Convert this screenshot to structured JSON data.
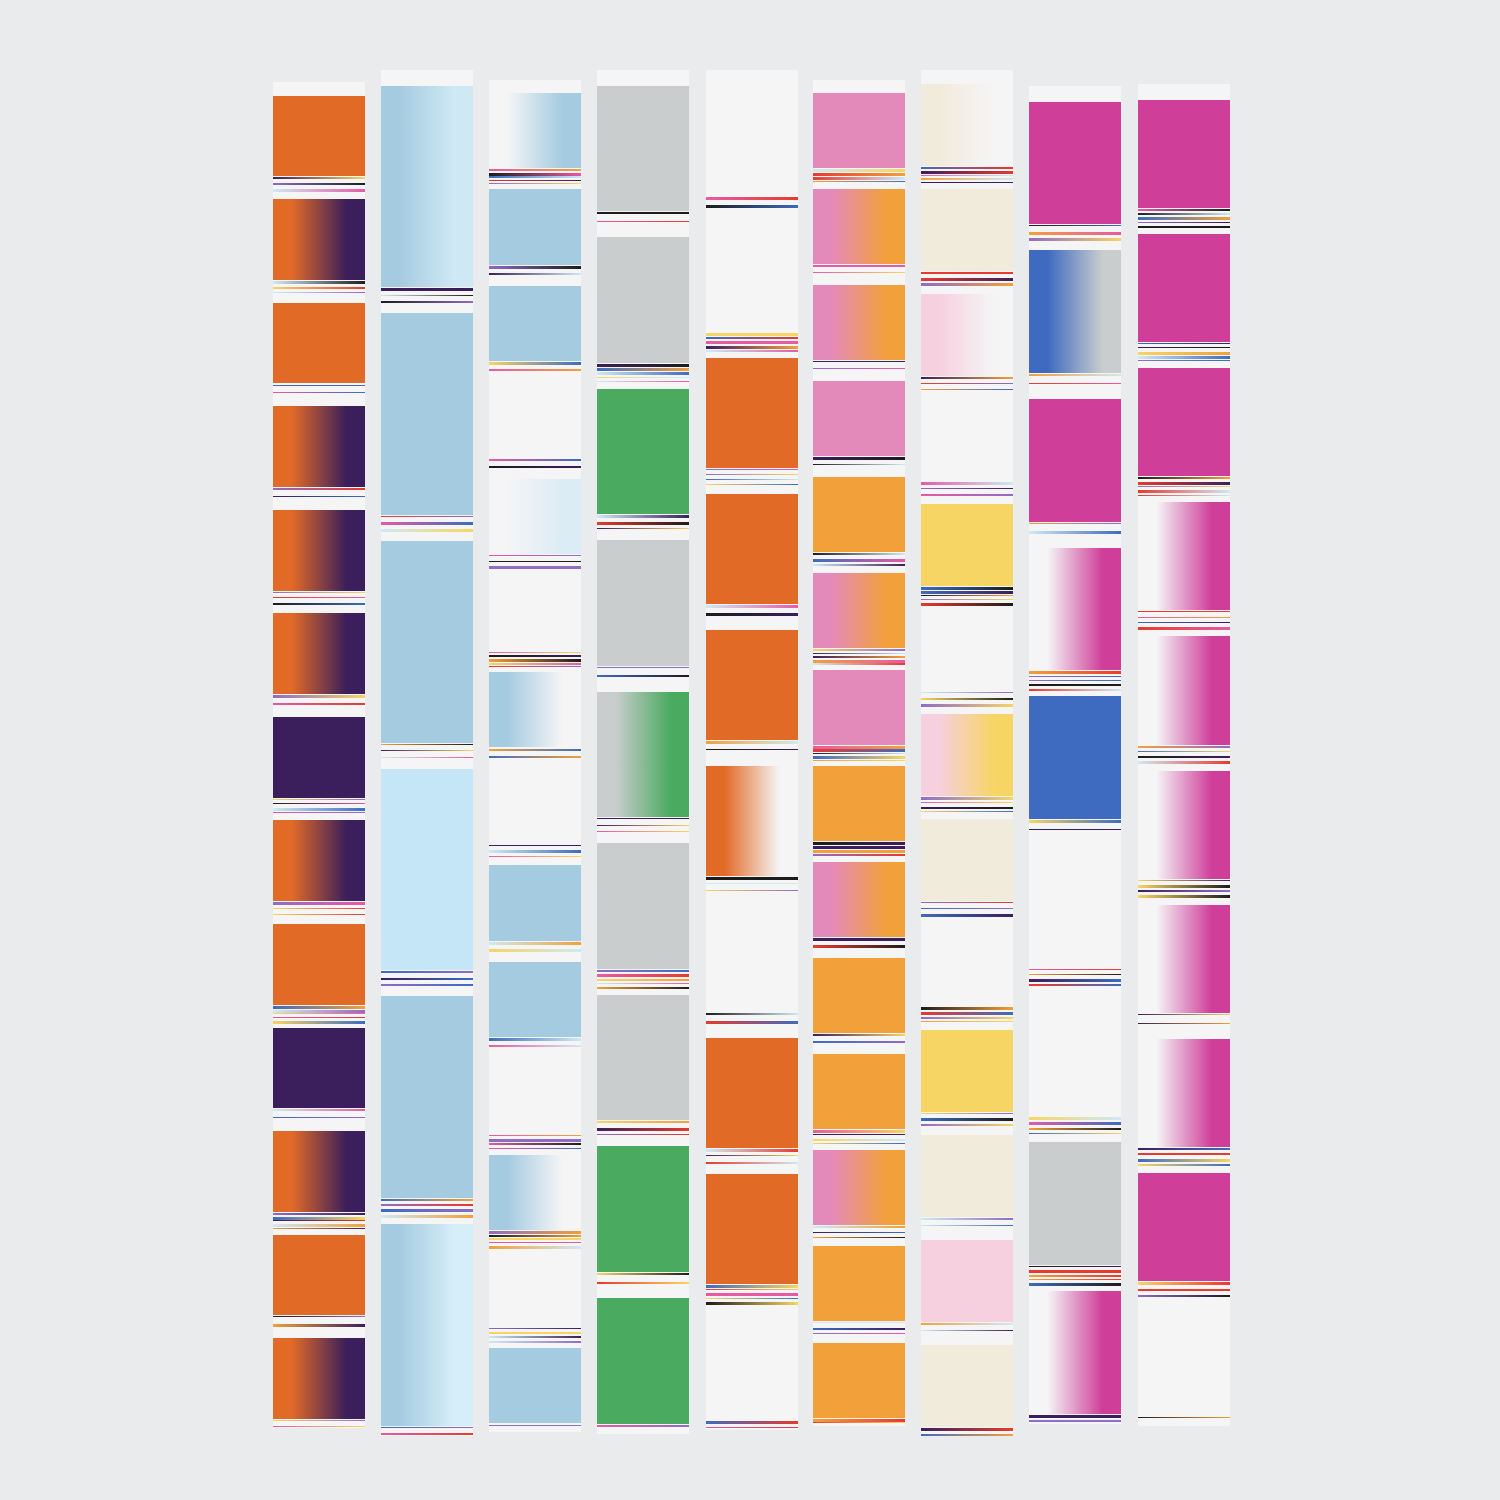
{
  "artwork": {
    "background": "#e9ebec",
    "stripe_base": "#f5f5f6",
    "columns": [
      {
        "name": "orange-indigo",
        "colors": [
          "#e26a27",
          "#3a1f5c"
        ],
        "bands": [
          {
            "kind": "solid",
            "c": "#e26a27"
          },
          {
            "kind": "fade",
            "from": "#e26a27",
            "to": "#3a1f5c"
          },
          {
            "kind": "solid",
            "c": "#e26a27"
          },
          {
            "kind": "fade",
            "from": "#e26a27",
            "to": "#3a1f5c"
          },
          {
            "kind": "fade",
            "from": "#e26a27",
            "to": "#3a1f5c"
          },
          {
            "kind": "fade",
            "from": "#e26a27",
            "to": "#3a1f5c"
          },
          {
            "kind": "solid",
            "c": "#3a1f5c"
          },
          {
            "kind": "fade",
            "from": "#e26a27",
            "to": "#3a1f5c"
          },
          {
            "kind": "solid",
            "c": "#e26a27"
          },
          {
            "kind": "solid",
            "c": "#3a1f5c"
          },
          {
            "kind": "fade",
            "from": "#e26a27",
            "to": "#3a1f5c"
          },
          {
            "kind": "solid",
            "c": "#e26a27"
          },
          {
            "kind": "fade",
            "from": "#e26a27",
            "to": "#3a1f5c"
          }
        ]
      },
      {
        "name": "light-blue",
        "colors": [
          "#a5cbe0",
          "#c5e6f6"
        ],
        "bands": [
          {
            "kind": "fade",
            "from": "#a5cbe0",
            "to": "#cfe9f4"
          },
          {
            "kind": "solid",
            "c": "#a5cbe0"
          },
          {
            "kind": "solid",
            "c": "#a5cbe0"
          },
          {
            "kind": "solid",
            "c": "#c5e6f6"
          },
          {
            "kind": "solid",
            "c": "#a5cbe0"
          },
          {
            "kind": "fade",
            "from": "#a5cbe0",
            "to": "#d6eef8"
          }
        ]
      },
      {
        "name": "blue-white",
        "colors": [
          "#a5cbe0",
          "#f5f5f6"
        ],
        "bands": [
          {
            "kind": "fade",
            "from": "#f5f5f6",
            "to": "#a5cbe0"
          },
          {
            "kind": "solid",
            "c": "#a5cbe0"
          },
          {
            "kind": "solid",
            "c": "#a5cbe0"
          },
          {
            "kind": "solid",
            "c": "#f5f5f6"
          },
          {
            "kind": "fade",
            "from": "#f5f5f6",
            "to": "#dcecf4"
          },
          {
            "kind": "solid",
            "c": "#f5f5f6"
          },
          {
            "kind": "fade",
            "from": "#a5cbe0",
            "to": "#f5f5f6"
          },
          {
            "kind": "solid",
            "c": "#f5f5f6"
          },
          {
            "kind": "solid",
            "c": "#a5cbe0"
          },
          {
            "kind": "solid",
            "c": "#a5cbe0"
          },
          {
            "kind": "solid",
            "c": "#f5f5f6"
          },
          {
            "kind": "fade",
            "from": "#a5cbe0",
            "to": "#f5f5f6"
          },
          {
            "kind": "solid",
            "c": "#f5f5f6"
          },
          {
            "kind": "solid",
            "c": "#a5cbe0"
          }
        ]
      },
      {
        "name": "grey-green",
        "colors": [
          "#c9cdce",
          "#4aaa5f",
          "#3e6bbf"
        ],
        "bands": [
          {
            "kind": "solid",
            "c": "#c9cdce"
          },
          {
            "kind": "solid",
            "c": "#c9cdce"
          },
          {
            "kind": "solid",
            "c": "#4aaa5f"
          },
          {
            "kind": "solid",
            "c": "#c9cdce"
          },
          {
            "kind": "fade",
            "from": "#c9cdce",
            "to": "#4aaa5f"
          },
          {
            "kind": "solid",
            "c": "#c9cdce"
          },
          {
            "kind": "solid",
            "c": "#c9cdce"
          },
          {
            "kind": "solid",
            "c": "#4aaa5f"
          },
          {
            "kind": "solid",
            "c": "#4aaa5f"
          }
        ]
      },
      {
        "name": "white-orange",
        "colors": [
          "#f5f5f6",
          "#e26a27"
        ],
        "bands": [
          {
            "kind": "solid",
            "c": "#f5f5f6"
          },
          {
            "kind": "solid",
            "c": "#f5f5f6"
          },
          {
            "kind": "solid",
            "c": "#e26a27"
          },
          {
            "kind": "solid",
            "c": "#e26a27"
          },
          {
            "kind": "solid",
            "c": "#e26a27"
          },
          {
            "kind": "fade",
            "from": "#e26a27",
            "to": "#f5f5f6"
          },
          {
            "kind": "solid",
            "c": "#f5f5f6"
          },
          {
            "kind": "solid",
            "c": "#e26a27"
          },
          {
            "kind": "solid",
            "c": "#e26a27"
          },
          {
            "kind": "solid",
            "c": "#f5f5f6"
          }
        ]
      },
      {
        "name": "pink-orange",
        "colors": [
          "#e48abb",
          "#f2a03a",
          "#e83a2e"
        ],
        "bands": [
          {
            "kind": "solid",
            "c": "#e48abb"
          },
          {
            "kind": "fade",
            "from": "#e48abb",
            "to": "#f2a03a"
          },
          {
            "kind": "fade",
            "from": "#e48abb",
            "to": "#f2a03a"
          },
          {
            "kind": "solid",
            "c": "#e48abb"
          },
          {
            "kind": "solid",
            "c": "#f2a03a"
          },
          {
            "kind": "fade",
            "from": "#e48abb",
            "to": "#f2a03a"
          },
          {
            "kind": "solid",
            "c": "#e48abb"
          },
          {
            "kind": "solid",
            "c": "#f2a03a"
          },
          {
            "kind": "fade",
            "from": "#e48abb",
            "to": "#f2a03a"
          },
          {
            "kind": "solid",
            "c": "#f2a03a"
          },
          {
            "kind": "solid",
            "c": "#f2a03a"
          },
          {
            "kind": "fade",
            "from": "#e48abb",
            "to": "#f2a03a"
          },
          {
            "kind": "solid",
            "c": "#f2a03a"
          },
          {
            "kind": "solid",
            "c": "#f2a03a"
          }
        ]
      },
      {
        "name": "cream-mix",
        "colors": [
          "#f1ebdc",
          "#f7d564",
          "#2a1a55",
          "#f6d0de"
        ],
        "bands": [
          {
            "kind": "fade",
            "from": "#f1ebdc",
            "to": "#f5f5f6"
          },
          {
            "kind": "solid",
            "c": "#f1ebdc"
          },
          {
            "kind": "fade",
            "from": "#f6d0de",
            "to": "#f5f5f6"
          },
          {
            "kind": "solid",
            "c": "#f5f5f6"
          },
          {
            "kind": "solid",
            "c": "#f7d564"
          },
          {
            "kind": "solid",
            "c": "#f5f5f6"
          },
          {
            "kind": "fade",
            "from": "#f6d0de",
            "to": "#f7d564"
          },
          {
            "kind": "solid",
            "c": "#f1ebdc"
          },
          {
            "kind": "solid",
            "c": "#f5f5f6"
          },
          {
            "kind": "solid",
            "c": "#f7d564"
          },
          {
            "kind": "solid",
            "c": "#f1ebdc"
          },
          {
            "kind": "solid",
            "c": "#f6d0de"
          },
          {
            "kind": "solid",
            "c": "#f1ebdc"
          }
        ]
      },
      {
        "name": "magenta-white",
        "colors": [
          "#cf3f9a",
          "#f5f5f6",
          "#3e6bbf"
        ],
        "bands": [
          {
            "kind": "solid",
            "c": "#cf3f9a"
          },
          {
            "kind": "fade",
            "from": "#3e6bbf",
            "to": "#c9cdce"
          },
          {
            "kind": "solid",
            "c": "#cf3f9a"
          },
          {
            "kind": "fade",
            "from": "#f5f5f6",
            "to": "#cf3f9a"
          },
          {
            "kind": "solid",
            "c": "#3e6bbf"
          },
          {
            "kind": "solid",
            "c": "#f5f5f6"
          },
          {
            "kind": "solid",
            "c": "#f5f5f6"
          },
          {
            "kind": "solid",
            "c": "#c9cdce"
          },
          {
            "kind": "fade",
            "from": "#f5f5f6",
            "to": "#cf3f9a"
          }
        ]
      },
      {
        "name": "magenta",
        "colors": [
          "#cf3f9a",
          "#f5f5f6"
        ],
        "bands": [
          {
            "kind": "solid",
            "c": "#cf3f9a"
          },
          {
            "kind": "solid",
            "c": "#cf3f9a"
          },
          {
            "kind": "solid",
            "c": "#cf3f9a"
          },
          {
            "kind": "fade",
            "from": "#f5f5f6",
            "to": "#cf3f9a"
          },
          {
            "kind": "fade",
            "from": "#f5f5f6",
            "to": "#cf3f9a"
          },
          {
            "kind": "fade",
            "from": "#f5f5f6",
            "to": "#cf3f9a"
          },
          {
            "kind": "fade",
            "from": "#f5f5f6",
            "to": "#cf3f9a"
          },
          {
            "kind": "fade",
            "from": "#f5f5f6",
            "to": "#cf3f9a"
          },
          {
            "kind": "solid",
            "c": "#cf3f9a"
          },
          {
            "kind": "solid",
            "c": "#f5f5f6"
          }
        ]
      }
    ],
    "accent_lines": [
      "#1c1c1c",
      "#3a1f5c",
      "#f7d564",
      "#e85aa3",
      "#8f6cc5",
      "#cfe9f4",
      "#e83a2e",
      "#f2a03a",
      "#3e6bbf"
    ]
  }
}
